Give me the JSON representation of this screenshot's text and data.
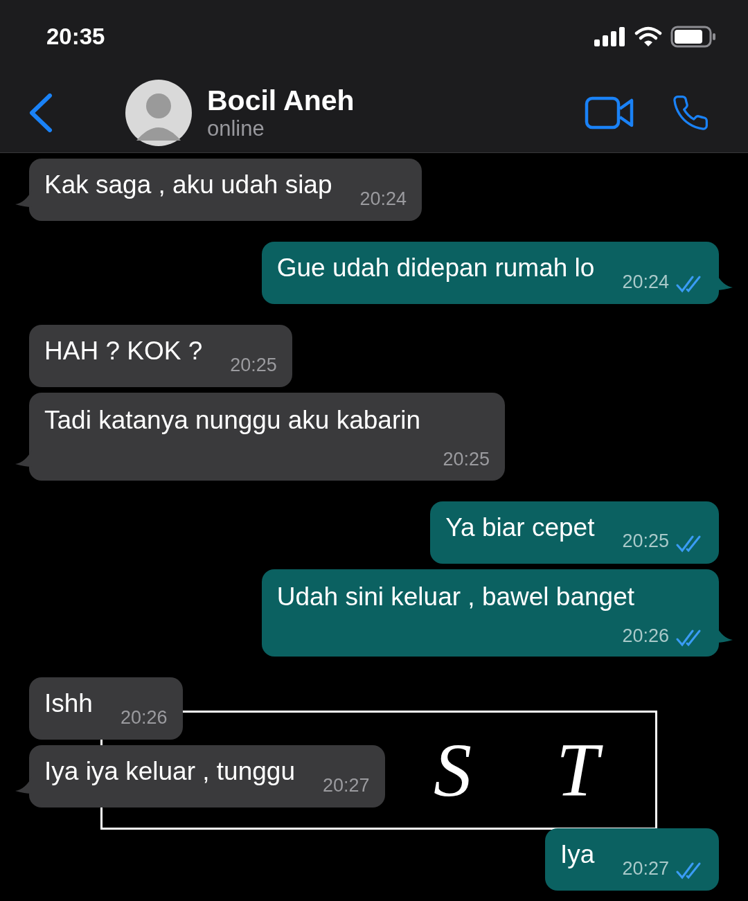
{
  "status_bar": {
    "time": "20:35"
  },
  "header": {
    "name": "Bocil Aneh",
    "status": "online"
  },
  "overlay": {
    "letters": [
      "S",
      "T"
    ]
  },
  "messages": [
    {
      "kind": "incoming",
      "text": "Kak saga , aku udah siap",
      "time": "20:24",
      "tail": true,
      "time_below": false
    },
    {
      "kind": "outgoing",
      "text": "Gue udah didepan rumah lo",
      "time": "20:24",
      "tail": true,
      "time_below": false,
      "read": true
    },
    {
      "kind": "incoming",
      "text": "HAH ? KOK ?",
      "time": "20:25",
      "tail": false,
      "time_below": false
    },
    {
      "kind": "incoming",
      "text": "Tadi katanya nunggu aku kabarin",
      "time": "20:25",
      "tail": true,
      "time_below": true
    },
    {
      "kind": "outgoing",
      "text": "Ya biar cepet",
      "time": "20:25",
      "tail": false,
      "time_below": false,
      "read": true
    },
    {
      "kind": "outgoing",
      "text": "Udah sini keluar , bawel banget",
      "time": "20:26",
      "tail": true,
      "time_below": true,
      "read": true
    },
    {
      "kind": "incoming",
      "text": "Ishh",
      "time": "20:26",
      "tail": false,
      "time_below": false
    },
    {
      "kind": "incoming",
      "text": "Iya iya keluar , tunggu",
      "time": "20:27",
      "tail": true,
      "time_below": false
    },
    {
      "kind": "outgoing",
      "text": "Iya",
      "time": "20:27",
      "tail": false,
      "time_below": false,
      "read": true
    }
  ]
}
